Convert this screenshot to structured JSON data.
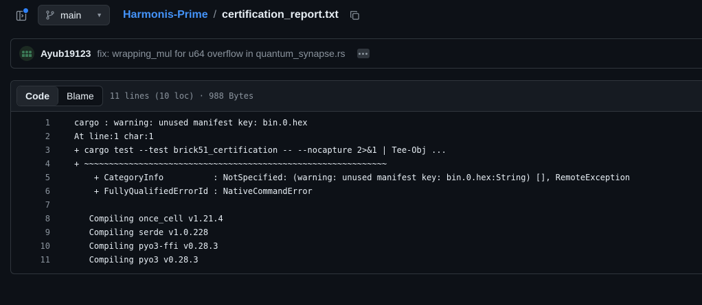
{
  "header": {
    "branch": "main",
    "repo": "Harmonis-Prime",
    "separator": "/",
    "file": "certification_report.txt"
  },
  "commit": {
    "author": "Ayub19123",
    "message": "fix: wrapping_mul for u64 overflow in quantum_synapse.rs"
  },
  "file_view": {
    "tabs": [
      "Code",
      "Blame"
    ],
    "active_tab": "Code",
    "info": "11 lines (10 loc) · 988 Bytes"
  },
  "lines": [
    {
      "n": "1",
      "text": "cargo : warning: unused manifest key: bin.0.hex"
    },
    {
      "n": "2",
      "text": "At line:1 char:1"
    },
    {
      "n": "3",
      "text": "+ cargo test --test brick51_certification -- --nocapture 2>&1 | Tee-Obj ..."
    },
    {
      "n": "4",
      "text": "+ ~~~~~~~~~~~~~~~~~~~~~~~~~~~~~~~~~~~~~~~~~~~~~~~~~~~~~~~~~~~~~"
    },
    {
      "n": "5",
      "text": "    + CategoryInfo          : NotSpecified: (warning: unused manifest key: bin.0.hex:String) [], RemoteException"
    },
    {
      "n": "6",
      "text": "    + FullyQualifiedErrorId : NativeCommandError"
    },
    {
      "n": "7",
      "text": ""
    },
    {
      "n": "8",
      "text": "   Compiling once_cell v1.21.4"
    },
    {
      "n": "9",
      "text": "   Compiling serde v1.0.228"
    },
    {
      "n": "10",
      "text": "   Compiling pyo3-ffi v0.28.3"
    },
    {
      "n": "11",
      "text": "   Compiling pyo3 v0.28.3"
    }
  ],
  "colors": {
    "background": "#0d1117",
    "link": "#4493f8",
    "muted": "#8b949e",
    "border": "#30363d"
  }
}
